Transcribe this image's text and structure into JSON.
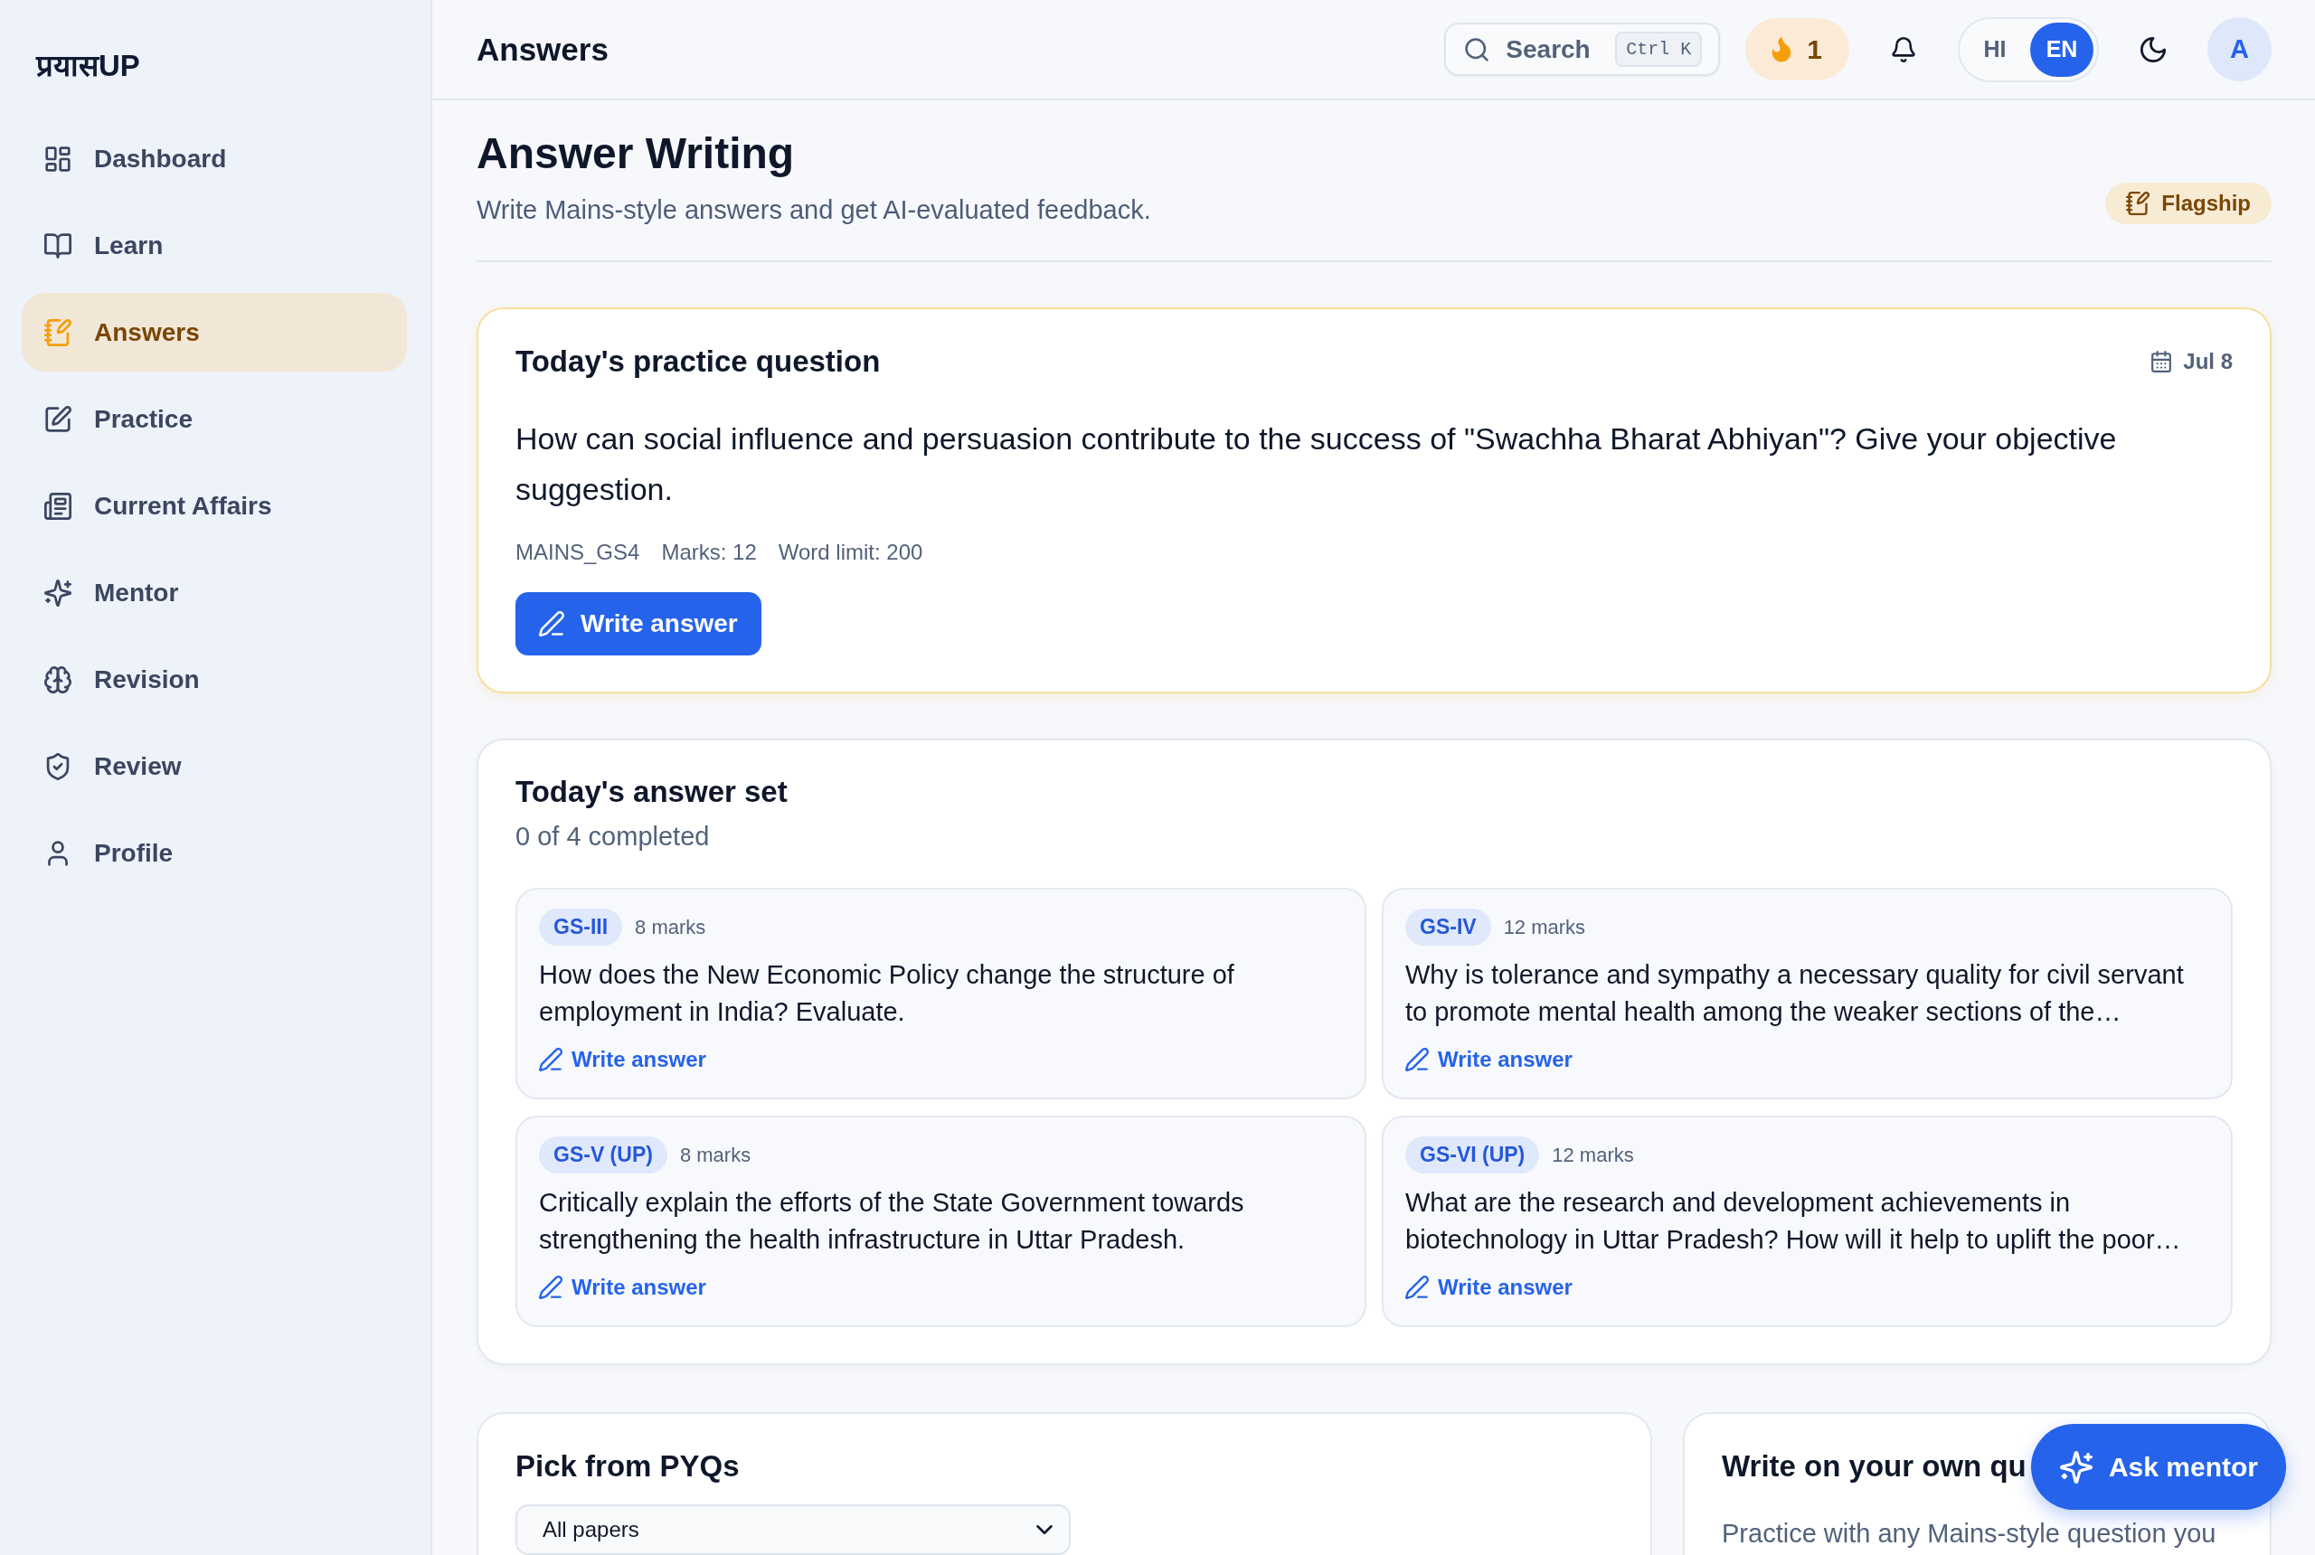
{
  "sidebar": {
    "logo": "प्रयासUP",
    "items": [
      {
        "label": "Dashboard",
        "selected": false
      },
      {
        "label": "Learn",
        "selected": false
      },
      {
        "label": "Answers",
        "selected": true
      },
      {
        "label": "Practice",
        "selected": false
      },
      {
        "label": "Current Affairs",
        "selected": false
      },
      {
        "label": "Mentor",
        "selected": false
      },
      {
        "label": "Revision",
        "selected": false
      },
      {
        "label": "Review",
        "selected": false
      },
      {
        "label": "Profile",
        "selected": false
      }
    ]
  },
  "topbar": {
    "title": "Answers",
    "search": {
      "placeholder": "Search",
      "shortcut": "Ctrl K"
    },
    "streak": "1",
    "languages": [
      {
        "label": "HI",
        "selected": false
      },
      {
        "label": "EN",
        "selected": true
      }
    ],
    "avatar": "A"
  },
  "header": {
    "title": "Answer Writing",
    "subtitle": "Write Mains-style answers and get AI-evaluated feedback.",
    "badge": "Flagship"
  },
  "practice_question": {
    "title": "Today's practice question",
    "date": "Jul 8",
    "question": "How can social influence and persuasion contribute to the success of \"Swachha Bharat Abhiyan\"? Give your objective suggestion.",
    "meta": [
      "MAINS_GS4",
      "Marks: 12",
      "Word limit: 200"
    ],
    "button": "Write answer"
  },
  "answer_set": {
    "title": "Today's answer set",
    "progress": "0 of 4 completed",
    "items": [
      {
        "paper": "GS-III",
        "marks": "8 marks",
        "question": "How does the New Economic Policy change the structure of employment in India? Evaluate.",
        "action": "Write answer"
      },
      {
        "paper": "GS-IV",
        "marks": "12 marks",
        "question": "Why is tolerance and sympathy a necessary quality for civil servant to promote mental health among the weaker sections of the…",
        "action": "Write answer"
      },
      {
        "paper": "GS-V (UP)",
        "marks": "8 marks",
        "question": "Critically explain the efforts of the State Government towards strengthening the health infrastructure in Uttar Pradesh.",
        "action": "Write answer"
      },
      {
        "paper": "GS-VI (UP)",
        "marks": "12 marks",
        "question": "What are the research and development achievements in biotechnology in Uttar Pradesh? How will it help to uplift the poor…",
        "action": "Write answer"
      }
    ]
  },
  "pyq": {
    "title": "Pick from PYQs",
    "filter": "All papers"
  },
  "own_question": {
    "title": "Write on your own qu",
    "text": "Practice with any Mains-style question you"
  },
  "ask_mentor": {
    "label": "Ask mentor"
  }
}
